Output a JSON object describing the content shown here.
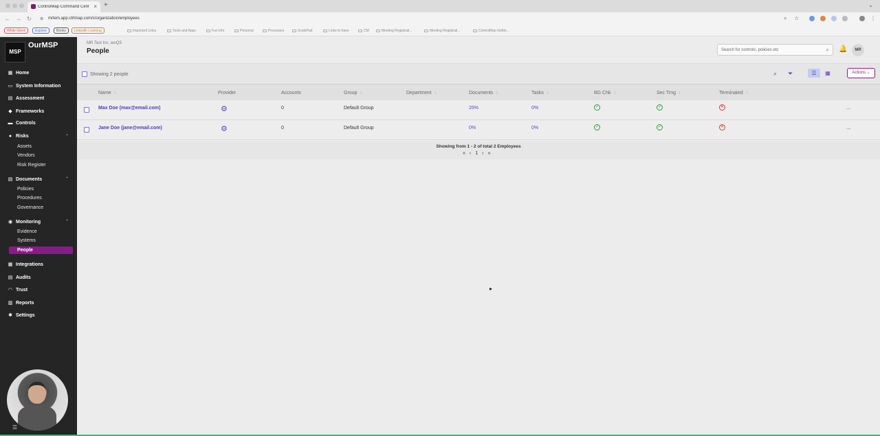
{
  "browser": {
    "tab_title": "ControlMap Command Center",
    "tab_close": "×",
    "new_tab": "+",
    "url_info": "⚙",
    "url": "mrtem.app.ctrlmap.com/s/organization/employees",
    "bookmarks_chips": [
      {
        "label": "White Glove",
        "color": "#d9534f"
      },
      {
        "label": "Explore",
        "color": "#5b6fd6"
      },
      {
        "label": "Books",
        "color": "#555555"
      },
      {
        "label": "LinkedIn Learning",
        "color": "#c08a2e"
      }
    ],
    "bookmarks": [
      "Important Links",
      "Tools and Apps",
      "Fun Info",
      "Personal",
      "Processes",
      "ScalePad",
      "Links to have",
      "CM",
      "Meeting Registrati...",
      "Meeting Registrati...",
      "ControlMap Gettin..."
    ]
  },
  "sidebar": {
    "logo_text": "MSP",
    "brand": "OurMSP",
    "items": [
      {
        "label": "Home",
        "icon": "grid-icon",
        "glyph": "▦"
      },
      {
        "label": "System Information",
        "icon": "monitor-icon",
        "glyph": "▭"
      },
      {
        "label": "Assessment",
        "icon": "clipboard-icon",
        "glyph": "▤"
      },
      {
        "label": "Frameworks",
        "icon": "rocket-icon",
        "glyph": "◆"
      },
      {
        "label": "Controls",
        "icon": "sliders-icon",
        "glyph": "▬"
      },
      {
        "label": "Risks",
        "icon": "flame-icon",
        "glyph": "●"
      }
    ],
    "risks_sub": [
      "Assets",
      "Vendors",
      "Risk Register"
    ],
    "documents": {
      "label": "Documents",
      "glyph": "▤",
      "sub": [
        "Policies",
        "Procedures",
        "Governance"
      ]
    },
    "monitoring": {
      "label": "Monitoring",
      "glyph": "◉",
      "sub": [
        "Evidence",
        "Systems",
        "People"
      ]
    },
    "bottom_items": [
      {
        "label": "Integrations",
        "glyph": "▦"
      },
      {
        "label": "Audits",
        "glyph": "▤"
      },
      {
        "label": "Trust",
        "glyph": "◠"
      },
      {
        "label": "Reports",
        "glyph": "▥"
      },
      {
        "label": "Settings",
        "glyph": "✱"
      }
    ],
    "caret": "⌃",
    "collapse_glyph": "☰"
  },
  "header": {
    "org": "MR Test Inc. woQS",
    "title": "People",
    "search_placeholder": "Search for controls, policies etc",
    "search_glyph": "⌕",
    "bell_glyph": "🔔",
    "avatar": "MR"
  },
  "toolbar": {
    "showing": "Showing 2 people",
    "search_glyph": "⌕",
    "filter_glyph": "⏷",
    "list_glyph": "☰",
    "tree_glyph": "▦",
    "actions_label": "Actions ⌄"
  },
  "table": {
    "columns": [
      "Name",
      "Provider",
      "Accounts",
      "Group",
      "Department",
      "Documents",
      "Tasks",
      "BG Chk",
      "Sec Trng",
      "Terminated"
    ],
    "sort_glyph": "↑",
    "rows": [
      {
        "name": "Max Doe (max@email.com)",
        "accounts": "0",
        "group": "Default Group",
        "documents": "25%",
        "tasks": "0%",
        "bg_chk": "✓",
        "sec_trng": "✓",
        "terminated": "✕",
        "more": "..."
      },
      {
        "name": "Jane Doe (jane@email.com)",
        "accounts": "0",
        "group": "Default Group",
        "documents": "0%",
        "tasks": "0%",
        "bg_chk": "✓",
        "sec_trng": "✓",
        "terminated": "✕",
        "more": "..."
      }
    ],
    "provider_glyph": "⚙"
  },
  "footer": {
    "summary": "Showing from 1 - 2 of total 2 Employees",
    "first": "«",
    "prev": "‹",
    "page": "1",
    "next": "›",
    "last": "»"
  },
  "colors": {
    "accent": "#8a1b86",
    "link": "#4a3bbf",
    "ok": "#2a9d3a",
    "bad": "#d23b3b"
  }
}
